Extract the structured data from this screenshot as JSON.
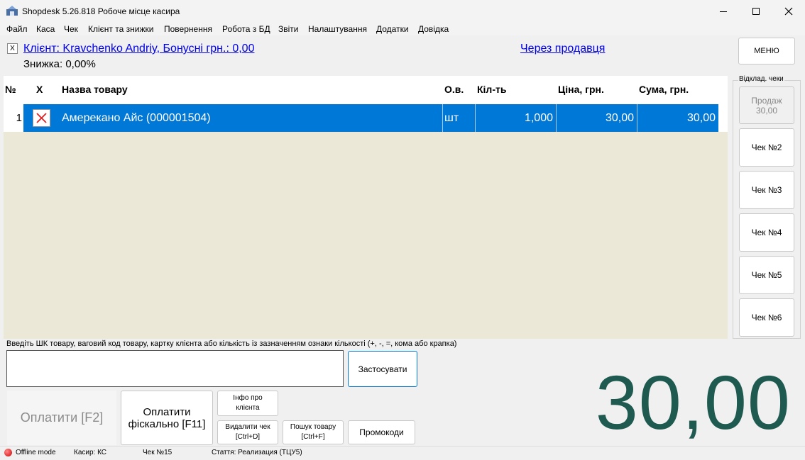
{
  "window": {
    "title": "Shopdesk 5.26.818 Робоче місце касира"
  },
  "menu": {
    "items": [
      "Файл",
      "Каса",
      "Чек",
      "Клієнт та знижки",
      "Повернення",
      "Робота з БД",
      "Звіти",
      "Налаштування",
      "Додатки",
      "Довідка"
    ]
  },
  "client": {
    "remove_label": "X",
    "link_text": "Клієнт: Kravchenko Andriy, Бонусні грн.: 0,00",
    "discount_text": "Знижка: 0,00%"
  },
  "seller_link": "Через продавця",
  "menu_button": "МЕНЮ",
  "table": {
    "headers": {
      "num": "№",
      "del": "X",
      "name": "Назва товару",
      "unit": "О.в.",
      "qty": "Кіл-ть",
      "price": "Ціна, грн.",
      "sum": "Сума, грн."
    },
    "rows": [
      {
        "num": "1",
        "name": "Амерекано Айс (000001504)",
        "unit": "шт",
        "qty": "1,000",
        "price": "30,00",
        "sum": "30,00"
      }
    ]
  },
  "deferred": {
    "label": "Відклад. чеки",
    "sale_button": {
      "line1": "Продаж",
      "line2": "30,00"
    },
    "checks": [
      "Чек №2",
      "Чек №3",
      "Чек №4",
      "Чек №5",
      "Чек №6"
    ]
  },
  "input": {
    "hint": "Введіть ШК товару, ваговий код товару,  картку клієнта або кількість із зазначенням ознаки кількості (+, -, =, кома або крапка)",
    "value": ""
  },
  "buttons": {
    "apply": "Застосувати",
    "pay": "Оплатити [F2]",
    "pay_fiscal_line1": "Оплатити",
    "pay_fiscal_line2": "фіскально [F11]",
    "client_info_line1": "Інфо про",
    "client_info_line2": "клієнта",
    "delete_check_line1": "Видалити чек",
    "delete_check_line2": "[Ctrl+D]",
    "search_line1": "Пошук товару",
    "search_line2": "[Ctrl+F]",
    "promo": "Промокоди"
  },
  "total": "30,00",
  "status": {
    "mode": "Offline mode",
    "cashier": "Касир: КС",
    "check": "Чек №15",
    "article": "Стаття: Реализация (ТЦУ5)"
  },
  "colors": {
    "selection": "#0078d7",
    "grid_background": "#ebe8d8",
    "total": "#1e5a50",
    "link": "#0000ee",
    "offline": "#d00000"
  }
}
